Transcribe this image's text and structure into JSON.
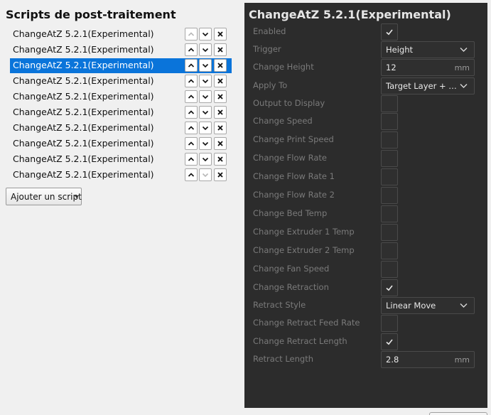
{
  "left_panel": {
    "title": "Scripts de post-traitement",
    "scripts": [
      {
        "label": "ChangeAtZ 5.2.1(Experimental)",
        "selected": false,
        "up_enabled": false,
        "down_enabled": true
      },
      {
        "label": "ChangeAtZ 5.2.1(Experimental)",
        "selected": false,
        "up_enabled": true,
        "down_enabled": true
      },
      {
        "label": "ChangeAtZ 5.2.1(Experimental)",
        "selected": true,
        "up_enabled": true,
        "down_enabled": true
      },
      {
        "label": "ChangeAtZ 5.2.1(Experimental)",
        "selected": false,
        "up_enabled": true,
        "down_enabled": true
      },
      {
        "label": "ChangeAtZ 5.2.1(Experimental)",
        "selected": false,
        "up_enabled": true,
        "down_enabled": true
      },
      {
        "label": "ChangeAtZ 5.2.1(Experimental)",
        "selected": false,
        "up_enabled": true,
        "down_enabled": true
      },
      {
        "label": "ChangeAtZ 5.2.1(Experimental)",
        "selected": false,
        "up_enabled": true,
        "down_enabled": true
      },
      {
        "label": "ChangeAtZ 5.2.1(Experimental)",
        "selected": false,
        "up_enabled": true,
        "down_enabled": true
      },
      {
        "label": "ChangeAtZ 5.2.1(Experimental)",
        "selected": false,
        "up_enabled": true,
        "down_enabled": true
      },
      {
        "label": "ChangeAtZ 5.2.1(Experimental)",
        "selected": false,
        "up_enabled": true,
        "down_enabled": false
      }
    ],
    "add_button_label": "Ajouter un script"
  },
  "right_panel": {
    "title": "ChangeAtZ 5.2.1(Experimental)",
    "settings": [
      {
        "label": "Enabled",
        "type": "checkbox",
        "checked": true
      },
      {
        "label": "Trigger",
        "type": "combo",
        "value": "Height"
      },
      {
        "label": "Change Height",
        "type": "field",
        "value": "12",
        "unit": "mm"
      },
      {
        "label": "Apply To",
        "type": "combo",
        "value": "Target Layer + Subsequent Layers"
      },
      {
        "label": "Output to Display",
        "type": "checkbox",
        "checked": false
      },
      {
        "label": "Change Speed",
        "type": "checkbox",
        "checked": false
      },
      {
        "label": "Change Print Speed",
        "type": "checkbox",
        "checked": false
      },
      {
        "label": "Change Flow Rate",
        "type": "checkbox",
        "checked": false
      },
      {
        "label": "Change Flow Rate 1",
        "type": "checkbox",
        "checked": false
      },
      {
        "label": "Change Flow Rate 2",
        "type": "checkbox",
        "checked": false
      },
      {
        "label": "Change Bed Temp",
        "type": "checkbox",
        "checked": false
      },
      {
        "label": "Change Extruder 1 Temp",
        "type": "checkbox",
        "checked": false
      },
      {
        "label": "Change Extruder 2 Temp",
        "type": "checkbox",
        "checked": false
      },
      {
        "label": "Change Fan Speed",
        "type": "checkbox",
        "checked": false
      },
      {
        "label": "Change Retraction",
        "type": "checkbox",
        "checked": true
      },
      {
        "label": "Retract Style",
        "type": "combo",
        "value": "Linear Move"
      },
      {
        "label": "Change Retract Feed Rate",
        "type": "checkbox",
        "checked": false
      },
      {
        "label": "Change Retract Length",
        "type": "checkbox",
        "checked": true
      },
      {
        "label": "Retract Length",
        "type": "field",
        "value": "2.8",
        "unit": "mm"
      }
    ]
  },
  "colors": {
    "selection": "#0a74da",
    "panel_dark": "#2c2c2c",
    "background": "#f0f0f0"
  },
  "icons": {
    "move_up": "chevron-up-icon",
    "move_down": "chevron-down-icon",
    "remove": "close-icon",
    "check": "check-icon",
    "combo_arrow": "chevron-down-icon"
  }
}
